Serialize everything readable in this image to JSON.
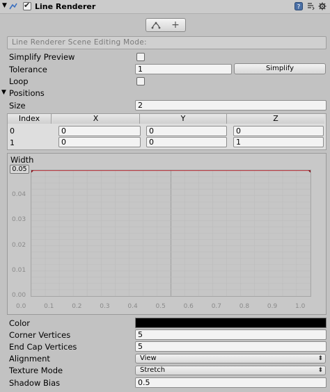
{
  "component": {
    "title": "Line Renderer"
  },
  "editing_mode": {
    "label": "Line Renderer Scene Editing Mode:",
    "add_symbol": "+"
  },
  "props": {
    "simplify_preview": {
      "label": "Simplify Preview"
    },
    "tolerance": {
      "label": "Tolerance",
      "value": "1",
      "button": "Simplify"
    },
    "loop": {
      "label": "Loop"
    },
    "positions": {
      "label": "Positions"
    },
    "size": {
      "label": "Size",
      "value": "2"
    }
  },
  "table": {
    "headers": [
      "Index",
      "X",
      "Y",
      "Z"
    ],
    "rows": [
      {
        "index": "0",
        "x": "0",
        "y": "0",
        "z": "0"
      },
      {
        "index": "1",
        "x": "0",
        "y": "0",
        "z": "1"
      }
    ]
  },
  "width_curve": {
    "label": "Width",
    "value": "0.05",
    "y_ticks": [
      "0.04",
      "0.03",
      "0.02",
      "0.01",
      "0.00"
    ],
    "x_ticks": [
      "0.0",
      "0.1",
      "0.2",
      "0.3",
      "0.4",
      "0.5",
      "0.6",
      "0.7",
      "0.8",
      "0.9",
      "1.0"
    ],
    "curve_color": "#c0141e",
    "points": [
      {
        "t": 0.0,
        "w": 0.05
      },
      {
        "t": 1.0,
        "w": 0.05
      }
    ]
  },
  "lower": {
    "color": {
      "label": "Color",
      "value": "#000000"
    },
    "corner_vertices": {
      "label": "Corner Vertices",
      "value": "5"
    },
    "end_cap_vertices": {
      "label": "End Cap Vertices",
      "value": "5"
    },
    "alignment": {
      "label": "Alignment",
      "value": "View"
    },
    "texture_mode": {
      "label": "Texture Mode",
      "value": "Stretch"
    },
    "shadow_bias": {
      "label": "Shadow Bias",
      "value": "0.5"
    }
  }
}
